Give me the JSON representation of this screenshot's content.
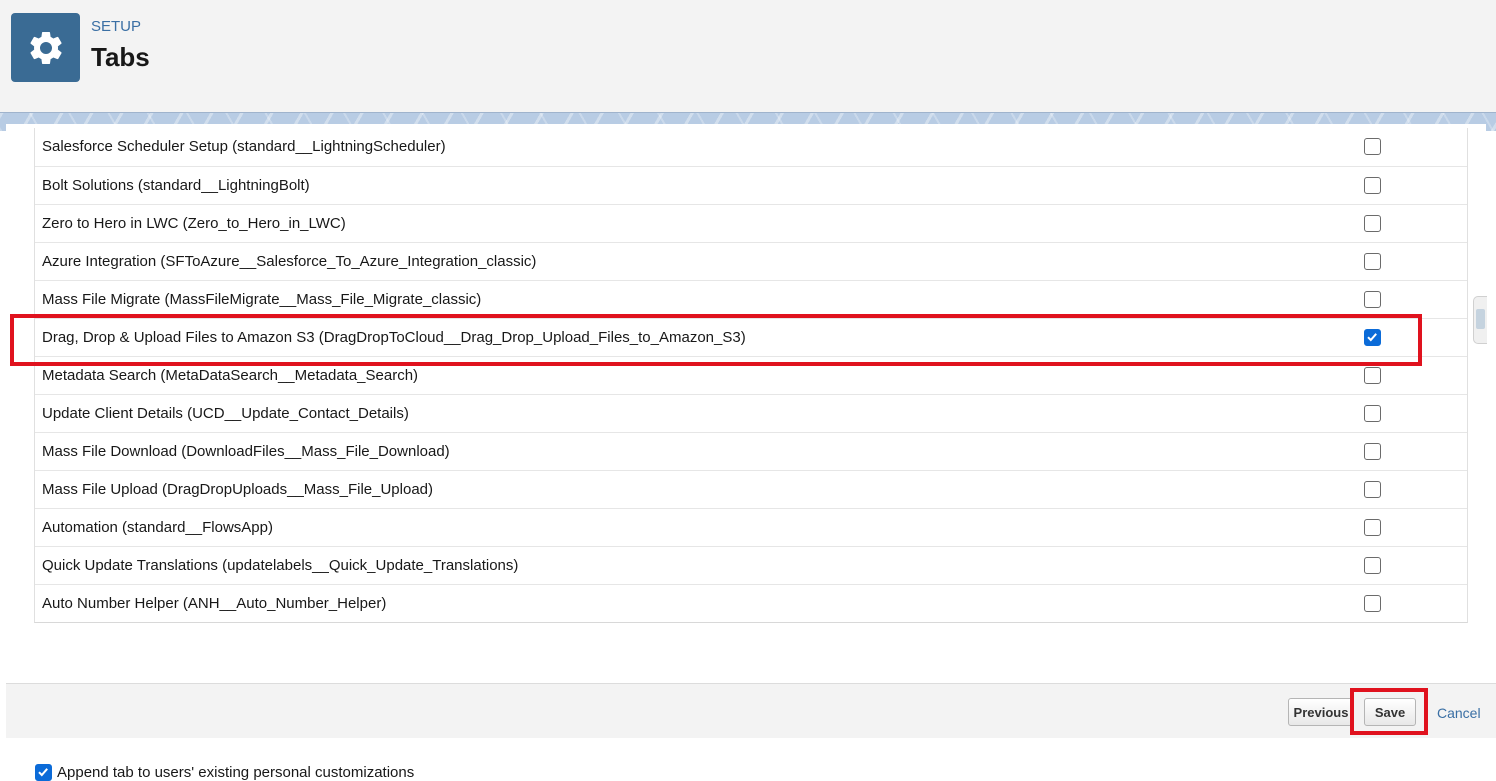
{
  "header": {
    "section": "SETUP",
    "title": "Tabs",
    "icon": "gear-icon",
    "icon_bg": "#3a6b94"
  },
  "rows": [
    {
      "label": "Salesforce Scheduler Setup (standard__LightningScheduler)",
      "checked": false
    },
    {
      "label": "Bolt Solutions (standard__LightningBolt)",
      "checked": false
    },
    {
      "label": "Zero to Hero in LWC (Zero_to_Hero_in_LWC)",
      "checked": false
    },
    {
      "label": "Azure Integration (SFToAzure__Salesforce_To_Azure_Integration_classic)",
      "checked": false
    },
    {
      "label": "Mass File Migrate (MassFileMigrate__Mass_File_Migrate_classic)",
      "checked": false
    },
    {
      "label": "Drag, Drop & Upload Files to Amazon S3 (DragDropToCloud__Drag_Drop_Upload_Files_to_Amazon_S3)",
      "checked": true
    },
    {
      "label": "Metadata Search (MetaDataSearch__Metadata_Search)",
      "checked": false
    },
    {
      "label": "Update Client Details (UCD__Update_Contact_Details)",
      "checked": false
    },
    {
      "label": "Mass File Download (DownloadFiles__Mass_File_Download)",
      "checked": false
    },
    {
      "label": "Mass File Upload (DragDropUploads__Mass_File_Upload)",
      "checked": false
    },
    {
      "label": "Automation (standard__FlowsApp)",
      "checked": false
    },
    {
      "label": "Quick Update Translations (updatelabels__Quick_Update_Translations)",
      "checked": false
    },
    {
      "label": "Auto Number Helper (ANH__Auto_Number_Helper)",
      "checked": false
    }
  ],
  "append_option": {
    "label": "Append tab to users' existing personal customizations",
    "checked": true
  },
  "footer": {
    "previous_label": "Previous",
    "save_label": "Save",
    "cancel_label": "Cancel"
  },
  "colors": {
    "checkbox_checked": "#0b6bd8",
    "highlight": "#e0121e",
    "link": "#3a6fa4"
  }
}
